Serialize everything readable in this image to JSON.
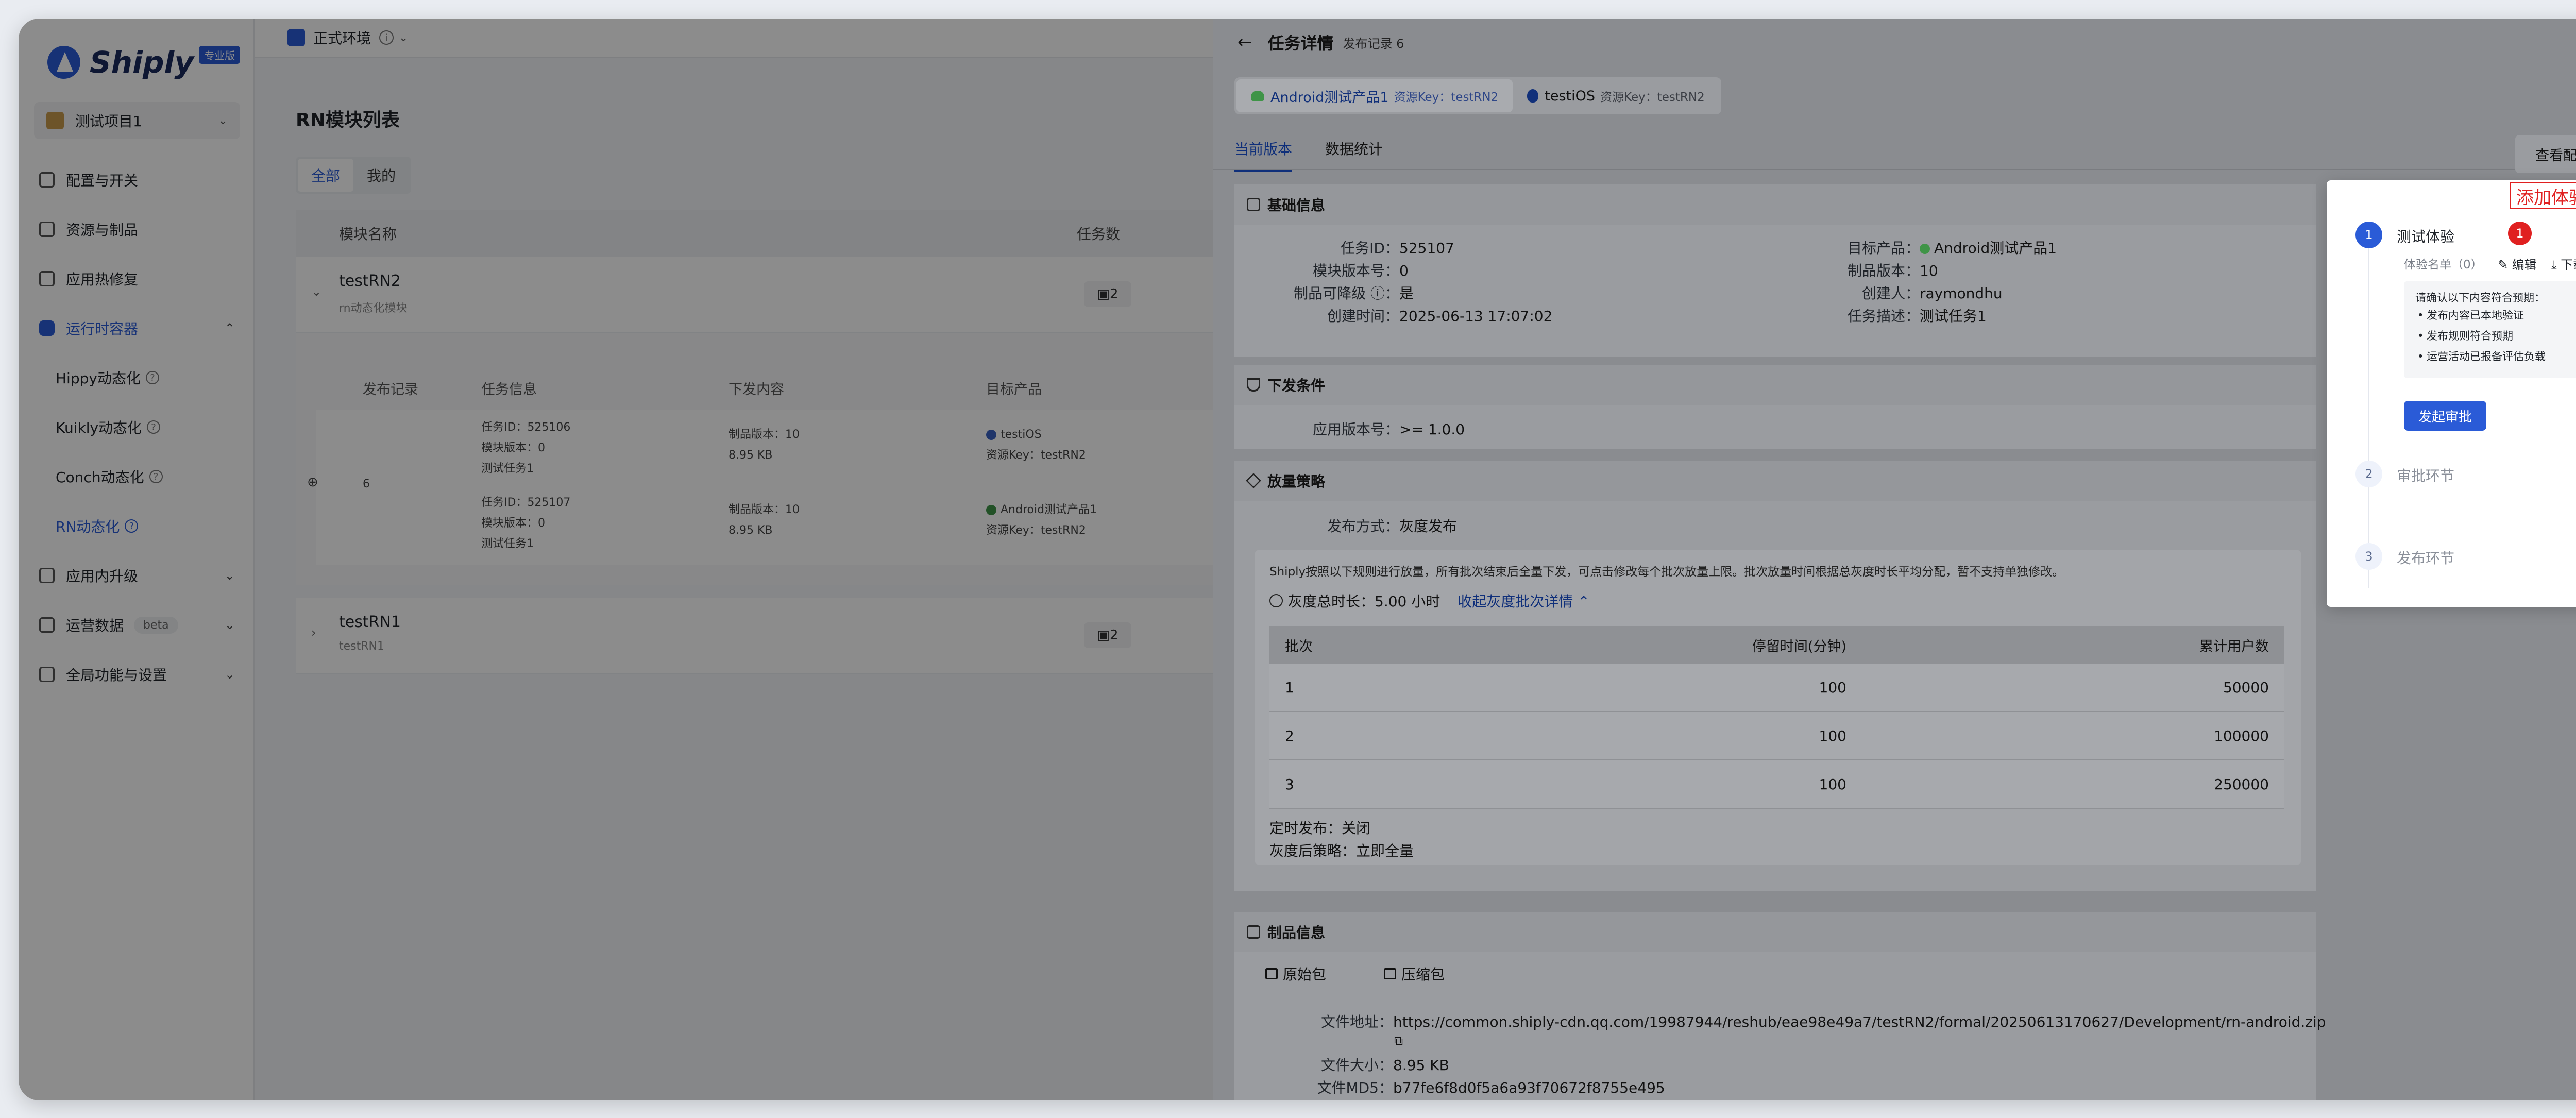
{
  "logo": {
    "text": "Shiply",
    "badge": "专业版"
  },
  "project": {
    "name": "测试项目1"
  },
  "nav": {
    "items": [
      {
        "label": "配置与开关"
      },
      {
        "label": "资源与制品"
      },
      {
        "label": "应用热修复"
      },
      {
        "label": "运行时容器"
      }
    ],
    "sub_items": [
      {
        "label": "Hippy动态化"
      },
      {
        "label": "Kuikly动态化"
      },
      {
        "label": "Conch动态化"
      },
      {
        "label": "RN动态化"
      }
    ],
    "after_items": [
      {
        "label": "应用内升级"
      },
      {
        "label": "运营数据",
        "badge": "beta"
      },
      {
        "label": "全局功能与设置"
      }
    ]
  },
  "env": {
    "label": "正式环境"
  },
  "main": {
    "title": "RN模块列表",
    "tabs": [
      "全部",
      "我的"
    ],
    "columns": {
      "name": "模块名称",
      "count": "任务数"
    },
    "modules": [
      {
        "name": "testRN2",
        "desc": "rn动态化模块",
        "count": "2"
      },
      {
        "name": "testRN1",
        "desc": "testRN1",
        "count": "2"
      }
    ],
    "sub_columns": [
      "发布记录",
      "任务信息",
      "下发内容",
      "目标产品"
    ],
    "sub_record": "6",
    "sub_rows": [
      {
        "task": "任务ID：525106",
        "ver": "模块版本：0",
        "desc": "测试任务1",
        "pkg": "制品版本：10",
        "size": "8.95 KB",
        "target": "testiOS",
        "key": "资源Key：testRN2"
      },
      {
        "task": "任务ID：525107",
        "ver": "模块版本：0",
        "desc": "测试任务1",
        "pkg": "制品版本：10",
        "size": "8.95 KB",
        "target": "Android测试产品1",
        "key": "资源Key：testRN2"
      }
    ]
  },
  "drawer": {
    "title": "任务详情",
    "record": "发布记录 6",
    "product_tabs": [
      {
        "name": "Android测试产品1",
        "key": "资源Key：testRN2"
      },
      {
        "name": "testiOS",
        "key": "资源Key：testRN2"
      }
    ],
    "view_tabs": [
      "当前版本",
      "数据统计"
    ],
    "config_button": "查看配置信息",
    "basic": {
      "title": "基础信息",
      "left": [
        {
          "k": "任务ID：",
          "v": "525107"
        },
        {
          "k": "模块版本号：",
          "v": "0"
        },
        {
          "k": "制品可降级 ⓘ：",
          "v": "是"
        },
        {
          "k": "创建时间：",
          "v": "2025-06-13 17:07:02"
        }
      ],
      "right": [
        {
          "k": "目标产品：",
          "v": "Android测试产品1"
        },
        {
          "k": "制品版本：",
          "v": "10"
        },
        {
          "k": "创建人：",
          "v": "raymondhu"
        },
        {
          "k": "任务描述：",
          "v": "测试任务1"
        }
      ]
    },
    "condition": {
      "title": "下发条件",
      "k": "应用版本号：",
      "v": ">= 1.0.0"
    },
    "strategy": {
      "title": "放量策略",
      "method_k": "发布方式：",
      "method_v": "灰度发布",
      "note": "Shiply按照以下规则进行放量，所有批次结束后全量下发，可点击修改每个批次放量上限。批次放量时间根据总灰度时长平均分配，暂不支持单独修改。",
      "duration_label": "灰度总时长：",
      "duration_value": "5.00 小时",
      "collapse_link": "收起灰度批次详情 ⌃",
      "table_headers": [
        "批次",
        "停留时间(分钟)",
        "累计用户数"
      ],
      "batches": [
        {
          "batch": "1",
          "stay": "100",
          "users": "50000"
        },
        {
          "batch": "2",
          "stay": "100",
          "users": "100000"
        },
        {
          "batch": "3",
          "stay": "100",
          "users": "250000"
        }
      ],
      "timed": "定时发布：关闭",
      "after": "灰度后策略：立即全量"
    },
    "artifact": {
      "title": "制品信息",
      "tabs": [
        "原始包",
        "压缩包"
      ],
      "url_k": "文件地址：",
      "url_v": "https://common.shiply-cdn.qq.com/19987944/reshub/eae98e49a7/testRN2/formal/20250613170627/Development/rn-android.zip",
      "size_k": "文件大小：",
      "size_v": "8.95 KB",
      "md5_k": "文件MD5：",
      "md5_v": "b77fe6f8d0f5a6a93f70672f8755e495"
    }
  },
  "popup": {
    "red_label": "添加体验名单",
    "red_dot": "1",
    "steps": [
      {
        "num": "1",
        "label": "测试体验"
      },
      {
        "num": "2",
        "label": "审批环节"
      },
      {
        "num": "3",
        "label": "发布环节"
      }
    ],
    "list_label": "体验名单（0）",
    "edit": "✎ 编辑",
    "download": "⤓ 下载",
    "check_title": "请确认以下内容符合预期：",
    "checks": [
      "发布内容已本地验证",
      "发布规则符合预期",
      "运营活动已报备评估负载"
    ],
    "approve_button": "发起审批"
  }
}
